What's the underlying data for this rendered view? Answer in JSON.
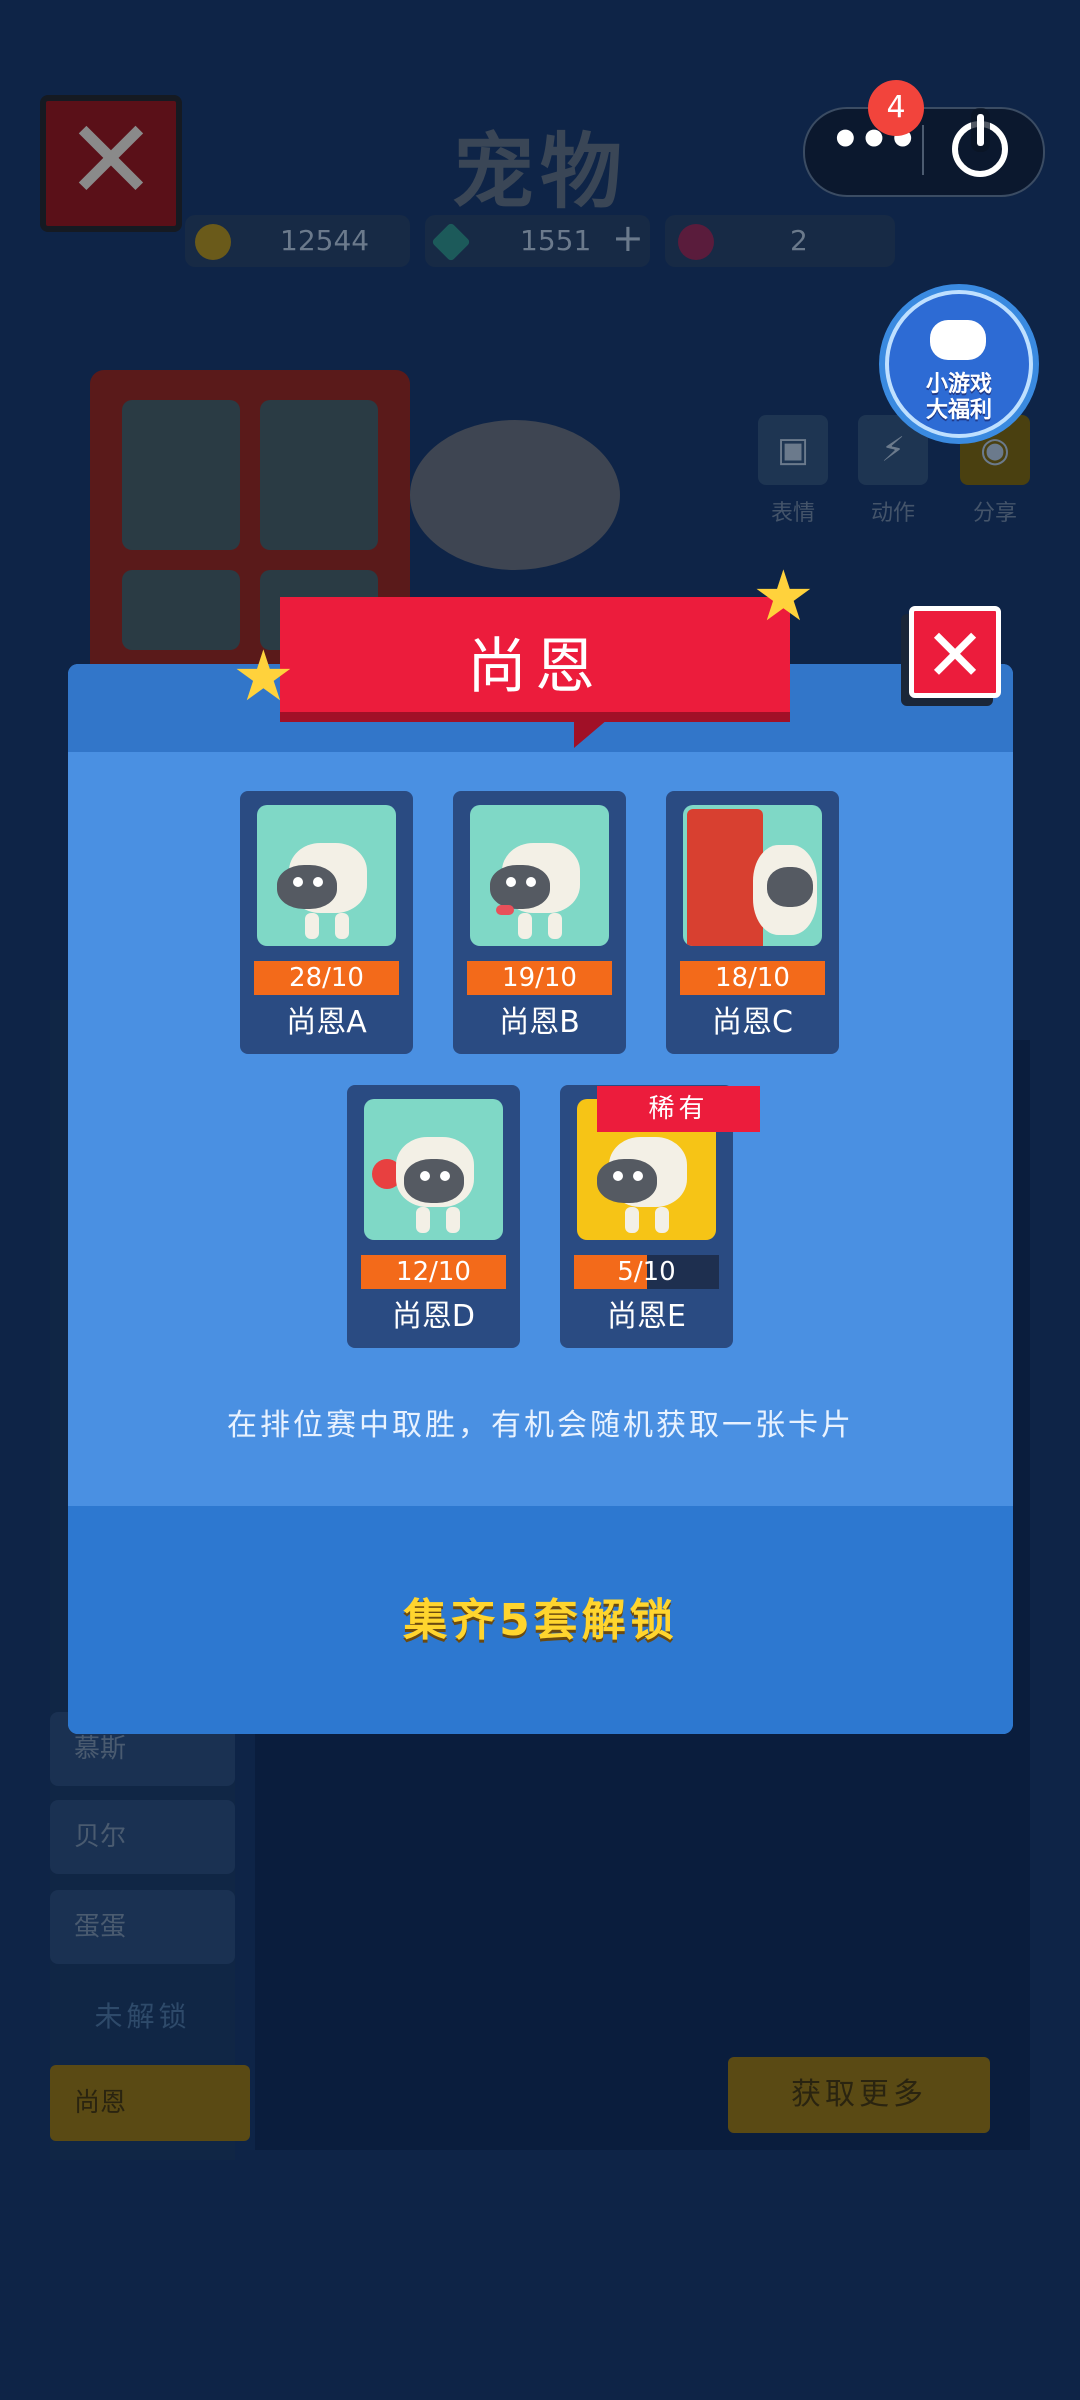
{
  "background": {
    "title": "宠物",
    "resources": {
      "gold": "12544",
      "diamond": "1551",
      "other": "2"
    },
    "side_actions": [
      "表情",
      "动作",
      "分享"
    ],
    "left_list": [
      "慕斯",
      "贝尔",
      "蛋蛋"
    ],
    "unlock_label": "未解锁",
    "selected_item": "尚恩",
    "get_more_button": "获取更多"
  },
  "capsule": {
    "badge_count": "4",
    "more_label": "•••"
  },
  "promo": {
    "text_line1": "小游戏",
    "text_line2": "大福利"
  },
  "modal": {
    "title": "尚恩",
    "cards": [
      {
        "name": "尚恩A",
        "progress_text": "28/10",
        "progress": 1.0,
        "rare": false
      },
      {
        "name": "尚恩B",
        "progress_text": "19/10",
        "progress": 1.0,
        "rare": false
      },
      {
        "name": "尚恩C",
        "progress_text": "18/10",
        "progress": 1.0,
        "rare": false
      },
      {
        "name": "尚恩D",
        "progress_text": "12/10",
        "progress": 1.0,
        "rare": false
      },
      {
        "name": "尚恩E",
        "progress_text": "5/10",
        "progress": 0.5,
        "rare": true
      }
    ],
    "rare_tag": "稀有",
    "hint": "在排位赛中取胜，有机会随机获取一张卡片",
    "unlock_text": "集齐5套解锁"
  },
  "colors": {
    "accent_red": "#ec1c3c",
    "panel_blue": "#4a90e2",
    "progress_orange": "#f36a1a",
    "gold_text": "#ffd52e"
  }
}
